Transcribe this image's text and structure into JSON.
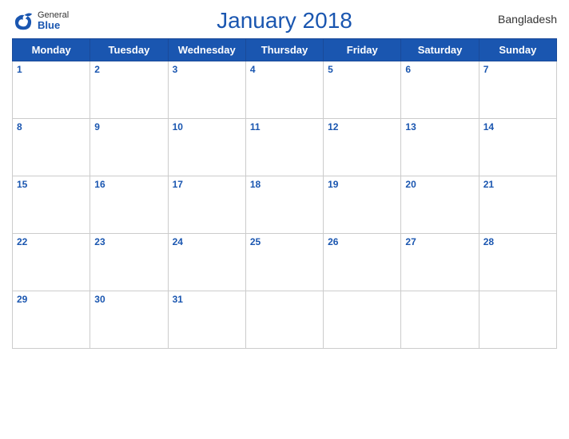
{
  "header": {
    "month_year": "January 2018",
    "country": "Bangladesh",
    "logo_general": "General",
    "logo_blue": "Blue"
  },
  "weekdays": [
    "Monday",
    "Tuesday",
    "Wednesday",
    "Thursday",
    "Friday",
    "Saturday",
    "Sunday"
  ],
  "weeks": [
    [
      1,
      2,
      3,
      4,
      5,
      6,
      7
    ],
    [
      8,
      9,
      10,
      11,
      12,
      13,
      14
    ],
    [
      15,
      16,
      17,
      18,
      19,
      20,
      21
    ],
    [
      22,
      23,
      24,
      25,
      26,
      27,
      28
    ],
    [
      29,
      30,
      31,
      null,
      null,
      null,
      null
    ]
  ],
  "colors": {
    "header_bg": "#1a56b0",
    "header_text": "#ffffff",
    "title_color": "#1a56b0",
    "day_number_color": "#1a56b0"
  }
}
